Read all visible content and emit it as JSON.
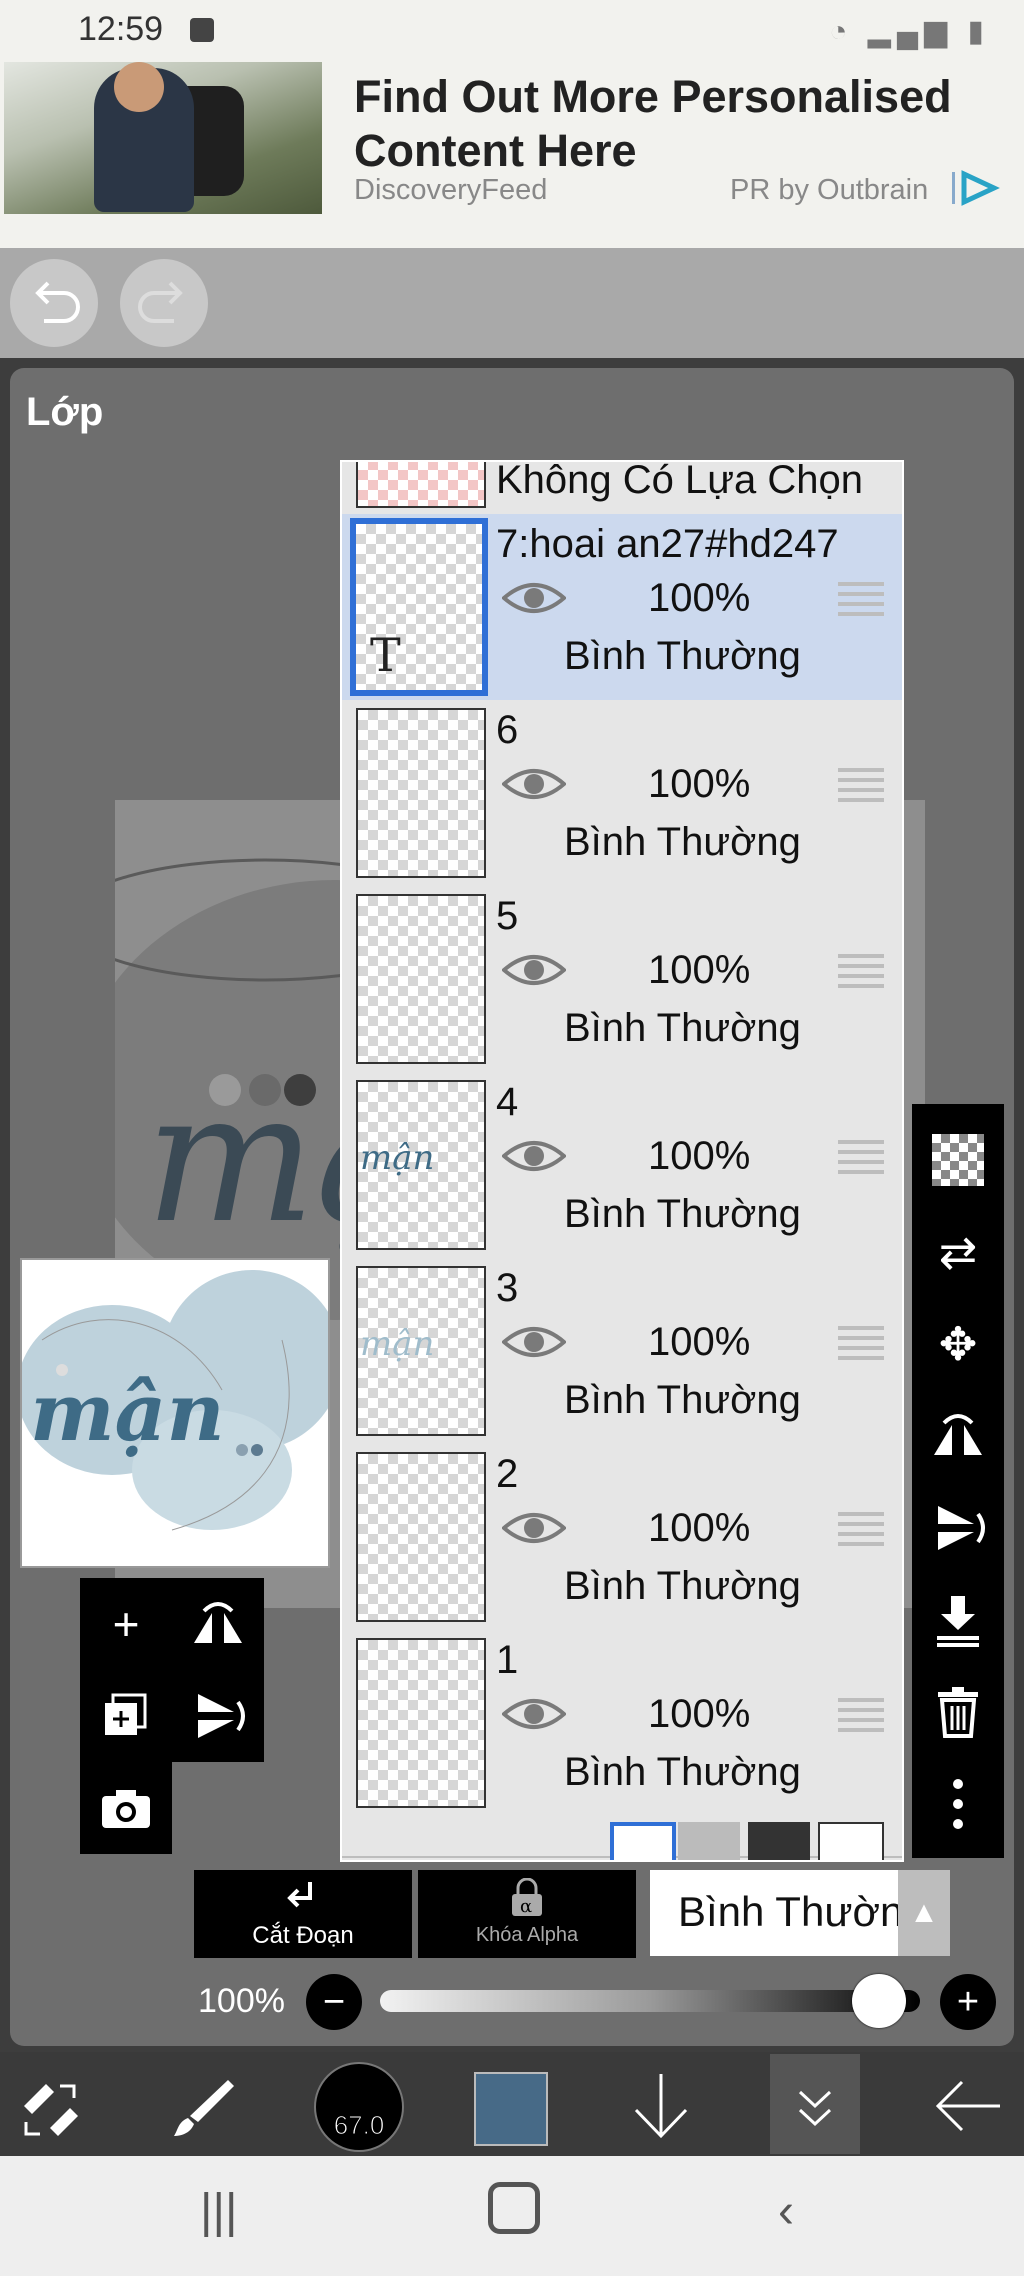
{
  "status_bar": {
    "time": "12:59",
    "icons": [
      "wifi-icon",
      "signal-icon",
      "battery-icon"
    ]
  },
  "ad": {
    "headline": "Find Out More Personalised Content Here",
    "source": "DiscoveryFeed",
    "pr_label": "PR by Outbrain"
  },
  "panel": {
    "title": "Lớp"
  },
  "layers": {
    "top_partial_label": "Không Có Lựa Chọn",
    "items": [
      {
        "name": "7:hoai an27#hd247",
        "opacity": "100%",
        "blend": "Bình Thường",
        "selected": true,
        "thumb_glyph": "T"
      },
      {
        "name": "6",
        "opacity": "100%",
        "blend": "Bình Thường",
        "selected": false,
        "thumb_glyph": ""
      },
      {
        "name": "5",
        "opacity": "100%",
        "blend": "Bình Thường",
        "selected": false,
        "thumb_glyph": ""
      },
      {
        "name": "4",
        "opacity": "100%",
        "blend": "Bình Thường",
        "selected": false,
        "thumb_glyph": "mận"
      },
      {
        "name": "3",
        "opacity": "100%",
        "blend": "Bình Thường",
        "selected": false,
        "thumb_glyph": "mận"
      },
      {
        "name": "2",
        "opacity": "100%",
        "blend": "Bình Thường",
        "selected": false,
        "thumb_glyph": ""
      },
      {
        "name": "1",
        "opacity": "100%",
        "blend": "Bình Thường",
        "selected": false,
        "thumb_glyph": ""
      }
    ]
  },
  "canvas": {
    "artwork_text": "mận"
  },
  "controls": {
    "clip_label": "Cắt Đoạn",
    "alpha_label": "Khóa Alpha",
    "blend_mode": "Bình Thường",
    "opacity_label": "100%",
    "opacity_value": 1.0
  },
  "bottom_bar": {
    "brush_size": "67.0",
    "color": "#476a87"
  },
  "colors": {
    "selected_row": "#ccd9ee",
    "accent_blue": "#2f6fd6",
    "panel_bg": "#6e6e6e"
  }
}
